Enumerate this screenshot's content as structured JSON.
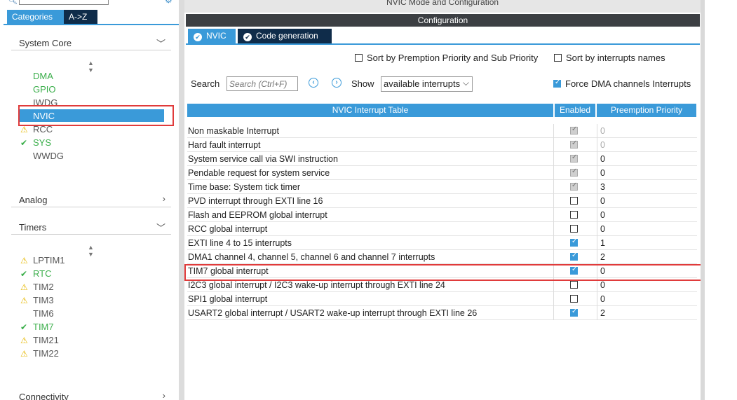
{
  "left": {
    "tabs": [
      "Categories",
      "A->Z"
    ],
    "sections": {
      "system_core": "System Core",
      "analog": "Analog",
      "timers": "Timers",
      "connectivity": "Connectivity"
    },
    "system_core_items": [
      {
        "label": "DMA",
        "status": "none",
        "color": "green"
      },
      {
        "label": "GPIO",
        "status": "none",
        "color": "green"
      },
      {
        "label": "IWDG",
        "status": "none",
        "color": "grey"
      },
      {
        "label": "NVIC",
        "status": "selected",
        "color": "white"
      },
      {
        "label": "RCC",
        "status": "warning",
        "color": "grey"
      },
      {
        "label": "SYS",
        "status": "check",
        "color": "green"
      },
      {
        "label": "WWDG",
        "status": "none",
        "color": "grey"
      }
    ],
    "timer_items": [
      {
        "label": "LPTIM1",
        "status": "warning",
        "color": "grey"
      },
      {
        "label": "RTC",
        "status": "check",
        "color": "green"
      },
      {
        "label": "TIM2",
        "status": "warning",
        "color": "grey"
      },
      {
        "label": "TIM3",
        "status": "warning",
        "color": "grey"
      },
      {
        "label": "TIM6",
        "status": "none",
        "color": "grey"
      },
      {
        "label": "TIM7",
        "status": "check",
        "color": "green"
      },
      {
        "label": "TIM21",
        "status": "warning",
        "color": "grey"
      },
      {
        "label": "TIM22",
        "status": "warning",
        "color": "grey"
      }
    ]
  },
  "right": {
    "mode_title": "NVIC Mode and Configuration",
    "config_title": "Configuration",
    "tabs": [
      "NVIC",
      "Code generation"
    ],
    "options": {
      "sort_premption": "Sort by Premption Priority and Sub Priority",
      "sort_premption_checked": false,
      "sort_names": "Sort by interrupts names",
      "sort_names_checked": false,
      "force_dma": "Force DMA channels Interrupts",
      "force_dma_checked": true
    },
    "search": {
      "label": "Search",
      "placeholder": "Search (Ctrl+F)",
      "show_label": "Show",
      "show_value": "available interrupts"
    },
    "table": {
      "headers": [
        "NVIC Interrupt Table",
        "Enabled",
        "Preemption Priority"
      ],
      "rows": [
        {
          "name": "Non maskable Interrupt",
          "enabled": "disabled-checked",
          "priority": "0"
        },
        {
          "name": "Hard fault interrupt",
          "enabled": "disabled-checked",
          "priority": "0"
        },
        {
          "name": "System service call via SWI instruction",
          "enabled": "disabled-checked",
          "priority": "0"
        },
        {
          "name": "Pendable request for system service",
          "enabled": "disabled-checked",
          "priority": "0"
        },
        {
          "name": "Time base: System tick timer",
          "enabled": "disabled-checked",
          "priority": "3"
        },
        {
          "name": "PVD interrupt through EXTI line 16",
          "enabled": "off",
          "priority": "0"
        },
        {
          "name": "Flash and EEPROM global interrupt",
          "enabled": "off",
          "priority": "0"
        },
        {
          "name": "RCC global interrupt",
          "enabled": "off",
          "priority": "0"
        },
        {
          "name": "EXTI line 4 to 15 interrupts",
          "enabled": "on",
          "priority": "1"
        },
        {
          "name": "DMA1 channel 4, channel 5, channel 6 and channel 7 interrupts",
          "enabled": "on",
          "priority": "2"
        },
        {
          "name": "TIM7 global interrupt",
          "enabled": "on",
          "priority": "0"
        },
        {
          "name": "I2C3 global interrupt / I2C3 wake-up interrupt through EXTI line 24",
          "enabled": "off",
          "priority": "0"
        },
        {
          "name": "SPI1 global interrupt",
          "enabled": "off",
          "priority": "0"
        },
        {
          "name": "USART2 global interrupt / USART2 wake-up interrupt through EXTI line 26",
          "enabled": "on",
          "priority": "2"
        }
      ]
    }
  },
  "colors": {
    "accent": "#3a9ad9",
    "dark_tab": "#0f2c4a",
    "highlight_box": "#e03b3b",
    "green": "#3aae4a",
    "warning": "#e6b800"
  }
}
